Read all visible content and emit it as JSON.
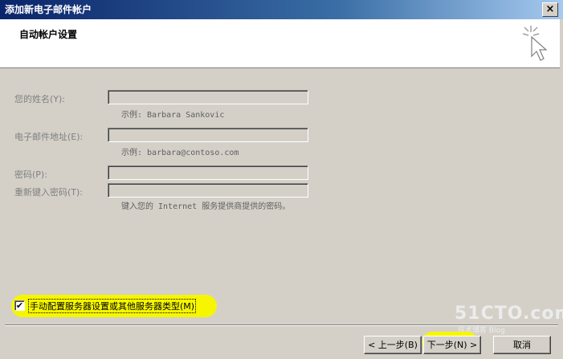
{
  "window": {
    "title": "添加新电子邮件帐户",
    "close_label": "×"
  },
  "header": {
    "heading": "自动帐户设置"
  },
  "form": {
    "name": {
      "label": "您的姓名(Y):",
      "value": "",
      "hint": "示例: Barbara Sankovic"
    },
    "email": {
      "label": "电子邮件地址(E):",
      "value": "",
      "hint": "示例: barbara@contoso.com"
    },
    "password": {
      "label": "密码(P):",
      "value": ""
    },
    "confirm": {
      "label": "重新键入密码(T):",
      "value": "",
      "hint": "键入您的 Internet 服务提供商提供的密码。"
    }
  },
  "manual": {
    "label": "手动配置服务器设置或其他服务器类型(M)",
    "checked": true
  },
  "buttons": {
    "back": "< 上一步(B)",
    "next": "下一步(N) >",
    "cancel": "取消"
  },
  "watermark": {
    "main": "51CTO.com",
    "sub": "技术博客 Blog"
  },
  "colors": {
    "highlight": "#f6f600",
    "face": "#d4d0c8",
    "titlebar": "#0a246a"
  }
}
